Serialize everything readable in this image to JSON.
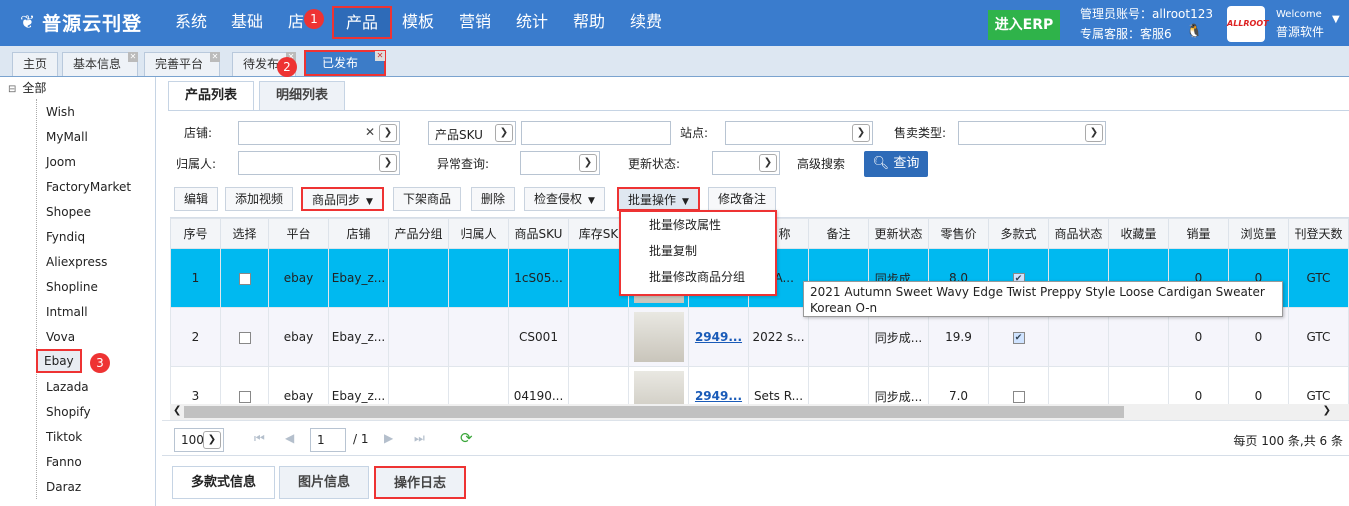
{
  "app": {
    "logo": "普源云刊登"
  },
  "top_menu": [
    {
      "label": "系统"
    },
    {
      "label": "基础"
    },
    {
      "label": "店"
    },
    {
      "label": "产品"
    },
    {
      "label": "模板"
    },
    {
      "label": "营销"
    },
    {
      "label": "统计"
    },
    {
      "label": "帮助"
    },
    {
      "label": "续费"
    }
  ],
  "badges": {
    "b1": "1",
    "b2": "2",
    "b3": "3"
  },
  "erp_button": "进入ERP",
  "admin": {
    "account": "管理员账号：allroot123",
    "service": "专属客服：客服6"
  },
  "user": {
    "welcome": "Welcome",
    "company": "普源软件",
    "logo_text": "ALLROOT"
  },
  "page_tabs": [
    {
      "label": "主页"
    },
    {
      "label": "基本信息"
    },
    {
      "label": "完善平台"
    },
    {
      "label": "待发布"
    },
    {
      "label": "已发布"
    }
  ],
  "sidebar": {
    "root": "全部",
    "items": [
      "Wish",
      "MyMall",
      "Joom",
      "FactoryMarket",
      "Shopee",
      "Fyndiq",
      "Aliexpress",
      "Shopline",
      "Intmall",
      "Vova",
      "Ebay",
      "Lazada",
      "Shopify",
      "Tiktok",
      "Fanno",
      "Daraz"
    ]
  },
  "sub_tabs": [
    {
      "label": "产品列表"
    },
    {
      "label": "明细列表"
    }
  ],
  "filters": {
    "shop": "店铺:",
    "sku_type": "产品SKU",
    "site": "站点:",
    "sale_type": "售卖类型:",
    "owner": "归属人:",
    "abnormal": "异常查询:",
    "update_status": "更新状态:",
    "advanced": "高级搜索",
    "query": "查询"
  },
  "toolbar": {
    "edit": "编辑",
    "add_video": "添加视频",
    "sync": "商品同步",
    "offline": "下架商品",
    "delete": "删除",
    "check": "检查侵权",
    "batch": "批量操作",
    "remark": "修改备注"
  },
  "batch_menu": [
    "批量修改属性",
    "批量复制",
    "批量修改商品分组"
  ],
  "table": {
    "headers": [
      "序号",
      "选择",
      "平台",
      "店铺",
      "产品分组",
      "归属人",
      "商品SKU",
      "库存SK",
      "",
      "",
      "名称",
      "备注",
      "更新状态",
      "零售价",
      "多款式",
      "商品状态",
      "收藏量",
      "销量",
      "浏览量",
      "刊登天数"
    ],
    "rows": [
      {
        "no": "1",
        "platform": "ebay",
        "shop": "Ebay_z...",
        "sku": "1cS05...",
        "item": "",
        "name": "1 A...",
        "status": "同步成...",
        "price": "8.0",
        "multi": true,
        "sales": "0",
        "views": "0",
        "days": "GTC"
      },
      {
        "no": "2",
        "platform": "ebay",
        "shop": "Ebay_z...",
        "sku": "CS001",
        "item": "2949...",
        "name": "2022 s...",
        "status": "同步成...",
        "price": "19.9",
        "multi": true,
        "sales": "0",
        "views": "0",
        "days": "GTC"
      },
      {
        "no": "3",
        "platform": "ebay",
        "shop": "Ebay_z...",
        "sku": "04190...",
        "item": "2949...",
        "name": "Sets R...",
        "status": "同步成...",
        "price": "7.0",
        "multi": false,
        "sales": "0",
        "views": "0",
        "days": "GTC"
      }
    ]
  },
  "tooltip": "2021 Autumn Sweet Wavy Edge Twist Preppy Style Loose Cardigan Sweater Korean O-n",
  "pager": {
    "page_size": "100",
    "page": "1",
    "total_pages": "/ 1",
    "summary": "每页 100 条,共 6 条"
  },
  "bottom_tabs": [
    {
      "label": "多款式信息"
    },
    {
      "label": "图片信息"
    },
    {
      "label": "操作日志"
    }
  ],
  "colors": {
    "nav": "#3a7ccd",
    "highlight_row": "#00b9f0",
    "annotation": "#e33"
  }
}
